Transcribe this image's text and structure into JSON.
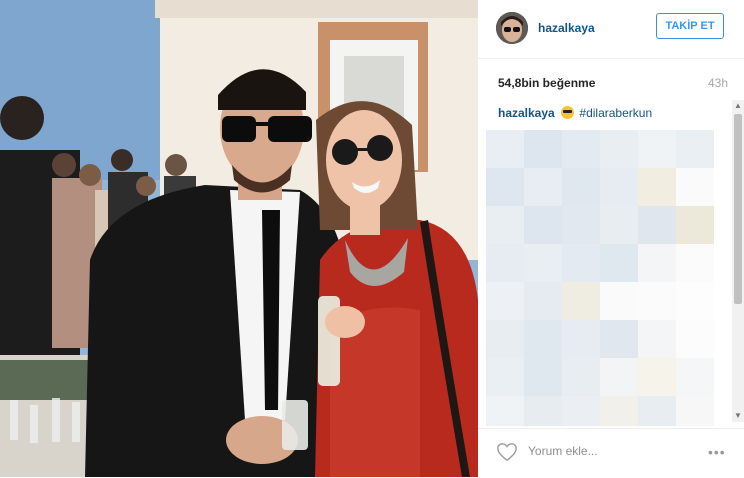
{
  "post": {
    "username": "hazalkaya",
    "follow_label": "TAKİP ET",
    "likes": "54,8bin beğenme",
    "time": "43h",
    "caption_user": "hazalkaya",
    "caption_hashtag": "#dilaraberkun",
    "comment_placeholder": "Yorum ekle...",
    "more_label": "•••"
  },
  "icons": {
    "avatar": "profile-avatar",
    "caption_emoji": "sunglasses-emoji",
    "like": "heart-icon",
    "more": "ellipsis-icon"
  },
  "colors": {
    "username": "#125688",
    "follow_border": "#4090db",
    "follow_text": "#3897f0",
    "meta_text": "#a5a7aa"
  }
}
